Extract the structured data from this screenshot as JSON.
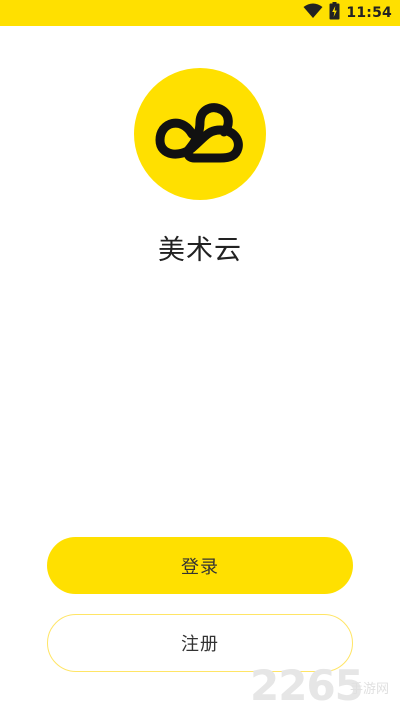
{
  "status_bar": {
    "time": "11:54",
    "icons": [
      "wifi-icon",
      "battery-icon"
    ],
    "background": "#ffe000"
  },
  "app": {
    "name": "美术云",
    "logo_icon": "cloud-loop-icon",
    "logo_color": "#ffe000"
  },
  "buttons": {
    "login_label": "登录",
    "register_label": "注册"
  },
  "watermark": {
    "number": "2265",
    "text": "手游网"
  },
  "colors": {
    "accent": "#ffe000",
    "text": "#222222",
    "outline": "#ffe566"
  }
}
